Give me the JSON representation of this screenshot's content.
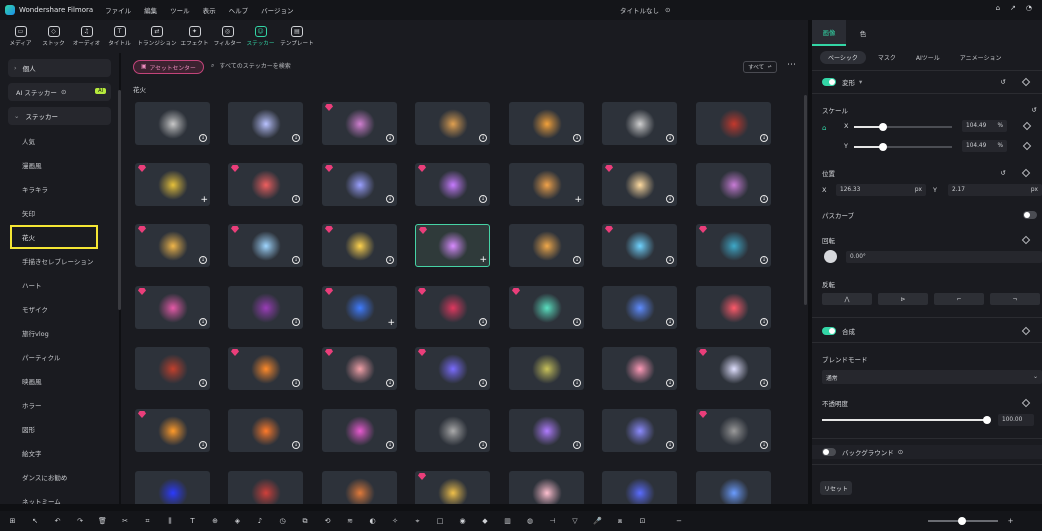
{
  "app": {
    "title": "Wondershare Filmora",
    "project": "タイトルなし"
  },
  "menu": [
    "ファイル",
    "編集",
    "ツール",
    "表示",
    "ヘルプ",
    "バージョン"
  ],
  "toolbar": [
    {
      "label": "メディア",
      "icon": "media-icon"
    },
    {
      "label": "ストック",
      "icon": "stock-icon"
    },
    {
      "label": "オーディオ",
      "icon": "audio-icon"
    },
    {
      "label": "タイトル",
      "icon": "title-icon"
    },
    {
      "label": "トランジション",
      "icon": "transition-icon"
    },
    {
      "label": "エフェクト",
      "icon": "effect-icon"
    },
    {
      "label": "フィルター",
      "icon": "filter-icon"
    },
    {
      "label": "ステッカー",
      "icon": "sticker-icon",
      "active": true
    },
    {
      "label": "テンプレート",
      "icon": "template-icon"
    }
  ],
  "sidebar": {
    "personal": "個人",
    "ai_sticker": "AI ステッカー",
    "ai_badge": "AI",
    "sticker": "ステッカー",
    "categories": [
      "人気",
      "漫画風",
      "キラキラ",
      "矢印",
      "花火",
      "手描きセレブレーション",
      "ハート",
      "モザイク",
      "旅行vlog",
      "パーティクル",
      "映画風",
      "ホラー",
      "図形",
      "絵文字",
      "ダンスにお勧め",
      "ネットミーム"
    ],
    "selected_index": 4
  },
  "main": {
    "asset_center": "アセットセンター",
    "search_placeholder": "すべてのステッカーを検索",
    "filter_all": "すべて",
    "section_title": "花火"
  },
  "stickers": [
    {
      "gem": false,
      "action": "download",
      "color": "#c8c8c8"
    },
    {
      "gem": false,
      "action": "download",
      "color": "#b9c2ff"
    },
    {
      "gem": true,
      "action": "download",
      "color": "#d07fd0"
    },
    {
      "gem": false,
      "action": "download",
      "color": "#e0a050"
    },
    {
      "gem": false,
      "action": "download",
      "color": "#f2a13a"
    },
    {
      "gem": false,
      "action": "download",
      "color": "#cfcfcf"
    },
    {
      "gem": false,
      "action": "download",
      "color": "#c4382c"
    },
    {
      "gem": true,
      "action": "add",
      "color": "#e6c13a"
    },
    {
      "gem": true,
      "action": "download",
      "color": "#ef5f5f"
    },
    {
      "gem": true,
      "action": "download",
      "color": "#9aa0ff"
    },
    {
      "gem": true,
      "action": "download",
      "color": "#c77bff"
    },
    {
      "gem": false,
      "action": "add",
      "color": "#f0a24a"
    },
    {
      "gem": true,
      "action": "download",
      "color": "#ffdba0"
    },
    {
      "gem": false,
      "action": "download",
      "color": "#c87cd6"
    },
    {
      "gem": true,
      "action": "download",
      "color": "#f0b64a"
    },
    {
      "gem": true,
      "action": "download",
      "color": "#9fd6ff"
    },
    {
      "gem": true,
      "action": "download",
      "color": "#ffd34d"
    },
    {
      "gem": true,
      "action": "add",
      "color": "#d88bff",
      "selected": true
    },
    {
      "gem": false,
      "action": "download",
      "color": "#f0a84a"
    },
    {
      "gem": true,
      "action": "download",
      "color": "#6fd3ff"
    },
    {
      "gem": true,
      "action": "download",
      "color": "#3ea9c9"
    },
    {
      "gem": true,
      "action": "download",
      "color": "#e65aa8"
    },
    {
      "gem": false,
      "action": "download",
      "color": "#9a3db8"
    },
    {
      "gem": true,
      "action": "add",
      "color": "#3f7cff"
    },
    {
      "gem": true,
      "action": "download",
      "color": "#e0385f"
    },
    {
      "gem": true,
      "action": "download",
      "color": "#5ae0c0"
    },
    {
      "gem": false,
      "action": "download",
      "color": "#5e8cff"
    },
    {
      "gem": false,
      "action": "download",
      "color": "#ff5a6a"
    },
    {
      "gem": false,
      "action": "download",
      "color": "#c2402c"
    },
    {
      "gem": true,
      "action": "download",
      "color": "#ff8a2a"
    },
    {
      "gem": true,
      "action": "download",
      "color": "#f2a0a8"
    },
    {
      "gem": true,
      "action": "download",
      "color": "#7a6cff"
    },
    {
      "gem": false,
      "action": "download",
      "color": "#c8c25a"
    },
    {
      "gem": false,
      "action": "download",
      "color": "#ff9ab8"
    },
    {
      "gem": true,
      "action": "download",
      "color": "#e0e0ff"
    },
    {
      "gem": true,
      "action": "download",
      "color": "#ff9a2a"
    },
    {
      "gem": false,
      "action": "download",
      "color": "#ff7a2a"
    },
    {
      "gem": false,
      "action": "download",
      "color": "#e85ad0"
    },
    {
      "gem": false,
      "action": "download",
      "color": "#aaaaaa"
    },
    {
      "gem": false,
      "action": "download",
      "color": "#b07cff"
    },
    {
      "gem": false,
      "action": "download",
      "color": "#8b8bff"
    },
    {
      "gem": true,
      "action": "download",
      "color": "#9a9a9a"
    },
    {
      "gem": false,
      "action": "none",
      "color": "#2b3aff"
    },
    {
      "gem": false,
      "action": "none",
      "color": "#d0403a"
    },
    {
      "gem": false,
      "action": "none",
      "color": "#e07a3a"
    },
    {
      "gem": true,
      "action": "none",
      "color": "#f0c04a"
    },
    {
      "gem": false,
      "action": "none",
      "color": "#ffc0d0"
    },
    {
      "gem": false,
      "action": "none",
      "color": "#5a6cff"
    },
    {
      "gem": false,
      "action": "none",
      "color": "#6a9cff"
    }
  ],
  "panel": {
    "tabs": [
      "画像",
      "色"
    ],
    "subtabs": [
      "ベーシック",
      "マスク",
      "AIツール",
      "アニメーション"
    ],
    "transform": "変形",
    "scale": "スケール",
    "x_label": "X",
    "y_label": "Y",
    "scale_x": "104.49",
    "scale_y": "104.49",
    "percent": "%",
    "position": "位置",
    "pos_x": "126.33",
    "pos_y": "2.17",
    "px": "px",
    "path_curve": "パスカーブ",
    "rotation": "回転",
    "rotation_value": "0.00°",
    "flip": "反転",
    "composite": "合成",
    "blend_mode": "ブレンドモード",
    "blend_value": "通常",
    "opacity": "不透明度",
    "opacity_value": "100.00",
    "background": "バックグラウンド",
    "reset": "リセット"
  }
}
